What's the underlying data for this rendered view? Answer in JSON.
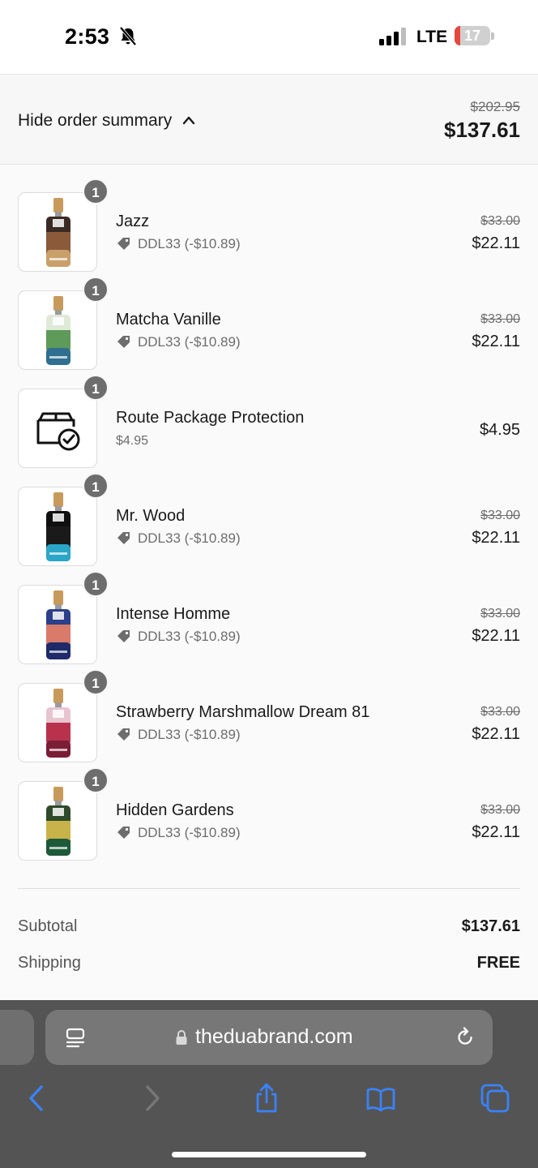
{
  "status_bar": {
    "time": "2:53",
    "network": "LTE",
    "battery": "17",
    "battery_level": 0.17
  },
  "summary": {
    "toggle_label": "Hide order summary",
    "original_total": "$202.95",
    "total": "$137.61"
  },
  "items": [
    {
      "name": "Jazz",
      "qty": "1",
      "discount": "DDL33 (-$10.89)",
      "original_price": "$33.00",
      "price": "$22.11",
      "colors": [
        "#3a2a25",
        "#8a5a3a",
        "#c9a06a"
      ]
    },
    {
      "name": "Matcha Vanille",
      "qty": "1",
      "discount": "DDL33 (-$10.89)",
      "original_price": "$33.00",
      "price": "$22.11",
      "colors": [
        "#dfe9d8",
        "#5e9a5a",
        "#2f6f8f"
      ]
    },
    {
      "name": "Route Package Protection",
      "qty": "1",
      "subtitle": "$4.95",
      "price": "$4.95"
    },
    {
      "name": "Mr. Wood",
      "qty": "1",
      "discount": "DDL33 (-$10.89)",
      "original_price": "$33.00",
      "price": "$22.11",
      "colors": [
        "#101010",
        "#1a1a1a",
        "#2aa6c8"
      ]
    },
    {
      "name": "Intense Homme",
      "qty": "1",
      "discount": "DDL33 (-$10.89)",
      "original_price": "$33.00",
      "price": "$22.11",
      "colors": [
        "#2b3f8a",
        "#d97a6a",
        "#1f2a6a"
      ]
    },
    {
      "name": "Strawberry Marshmallow Dream 81",
      "qty": "1",
      "discount": "DDL33 (-$10.89)",
      "original_price": "$33.00",
      "price": "$22.11",
      "colors": [
        "#e8c4cf",
        "#b8324e",
        "#7a1d35"
      ]
    },
    {
      "name": "Hidden Gardens",
      "qty": "1",
      "discount": "DDL33 (-$10.89)",
      "original_price": "$33.00",
      "price": "$22.11",
      "colors": [
        "#2f4a2a",
        "#c8b24a",
        "#1d5a3a"
      ]
    }
  ],
  "totals": {
    "subtotal_label": "Subtotal",
    "subtotal": "$137.61",
    "shipping_label": "Shipping",
    "shipping": "FREE"
  },
  "browser": {
    "url": "theduabrand.com"
  },
  "colors": {
    "accent": "#3a82f7",
    "badge": "#6d6d6d",
    "browser": "#545454"
  }
}
